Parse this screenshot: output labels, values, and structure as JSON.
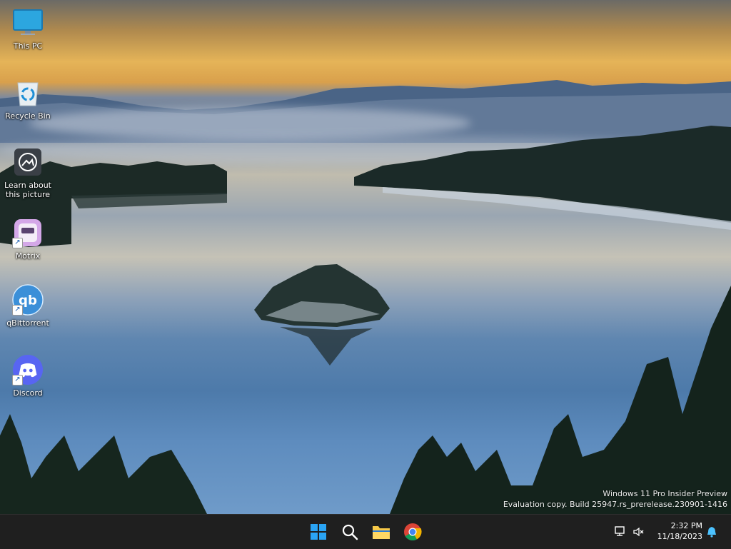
{
  "desktop": {
    "icons": [
      {
        "label": "This PC",
        "icon": "monitor-icon"
      },
      {
        "label": "Recycle Bin",
        "icon": "recycle-bin-icon"
      },
      {
        "label": "Learn about this picture",
        "icon": "camera-icon"
      },
      {
        "label": "Motrix",
        "icon": "motrix-icon"
      },
      {
        "label": "qBittorrent",
        "icon": "qbittorrent-icon"
      },
      {
        "label": "Discord",
        "icon": "discord-icon"
      }
    ],
    "watermark": {
      "line1": "Windows 11 Pro Insider Preview",
      "line2": "Evaluation copy. Build 25947.rs_prerelease.230901-1416"
    }
  },
  "taskbar": {
    "apps": [
      "start-icon",
      "search-icon",
      "file-explorer-icon",
      "chrome-icon"
    ],
    "clock": {
      "time": "2:32 PM",
      "date": "11/18/2023"
    },
    "colors": {
      "background": "#1f1f1f",
      "accent": "#0078d4"
    }
  }
}
